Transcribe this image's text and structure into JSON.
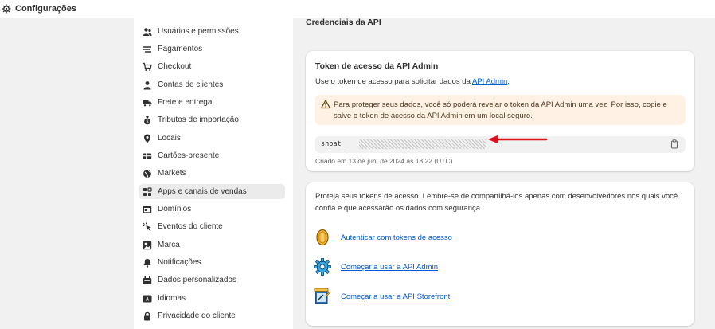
{
  "header": {
    "title": "Configurações",
    "icon": "gear-icon"
  },
  "sidebar": {
    "items": [
      {
        "label": "Usuários e permissões",
        "icon": "users-icon"
      },
      {
        "label": "Pagamentos",
        "icon": "payments-icon"
      },
      {
        "label": "Checkout",
        "icon": "cart-icon"
      },
      {
        "label": "Contas de clientes",
        "icon": "person-icon"
      },
      {
        "label": "Frete e entrega",
        "icon": "truck-icon"
      },
      {
        "label": "Tributos de importação",
        "icon": "money-bag-icon"
      },
      {
        "label": "Locais",
        "icon": "location-icon"
      },
      {
        "label": "Cartões-presente",
        "icon": "gift-card-icon"
      },
      {
        "label": "Markets",
        "icon": "globe-icon"
      },
      {
        "label": "Apps e canais de vendas",
        "icon": "apps-icon",
        "active": true
      },
      {
        "label": "Domínios",
        "icon": "domain-icon"
      },
      {
        "label": "Eventos do cliente",
        "icon": "cursor-click-icon"
      },
      {
        "label": "Marca",
        "icon": "brand-icon"
      },
      {
        "label": "Notificações",
        "icon": "bell-icon"
      },
      {
        "label": "Dados personalizados",
        "icon": "database-icon"
      },
      {
        "label": "Idiomas",
        "icon": "language-icon"
      },
      {
        "label": "Privacidade do cliente",
        "icon": "lock-icon"
      }
    ]
  },
  "main": {
    "section_title": "Credenciais da API",
    "token_card": {
      "title": "Token de acesso da API Admin",
      "desc_prefix": "Use o token de acesso para solicitar dados da ",
      "desc_link": "API Admin",
      "desc_suffix": ".",
      "warning": "Para proteger seus dados, você só poderá revelar o token da API Admin uma vez. Por isso, copie e salve o token de acesso da API Admin em um local seguro.",
      "token_prefix": "shpat_",
      "created": "Criado em 13 de jun. de 2024 às 18:22 (UTC)",
      "colors": {
        "warning_bg": "#fff1e3",
        "arrow": "#e0101e",
        "link": "#005bd3"
      }
    },
    "resources_card": {
      "desc": "Proteja seus tokens de acesso. Lembre-se de compartilhá-los apenas com desenvolvedores nos quais você confia e que acessarão os dados com segurança.",
      "links": [
        {
          "label": "Autenticar com tokens de acesso",
          "icon": "coin-icon"
        },
        {
          "label": "Começar a usar a API Admin",
          "icon": "gear-badge-icon"
        },
        {
          "label": "Começar a usar a API Storefront",
          "icon": "storefront-icon"
        }
      ]
    }
  }
}
